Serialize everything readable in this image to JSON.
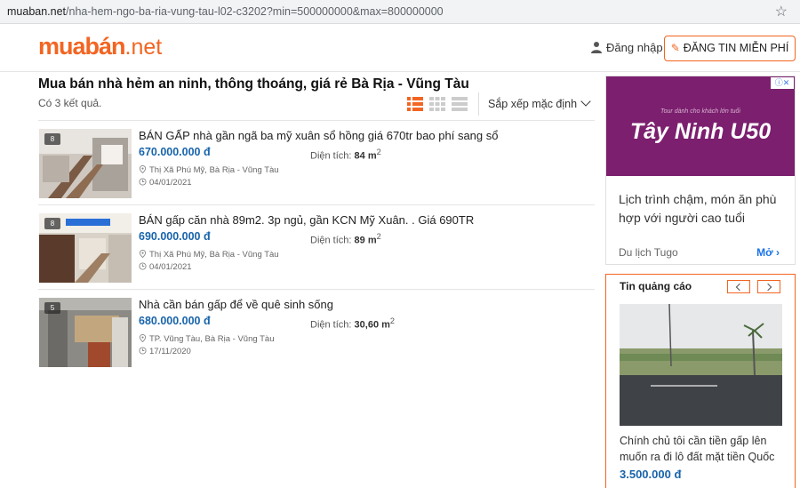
{
  "browser": {
    "url_domain": "muaban.net",
    "url_path": "/nha-hem-ngo-ba-ria-vung-tau-l02-c3202?min=500000000&max=800000000"
  },
  "header": {
    "logo_main": "muabán",
    "logo_suffix": ".net",
    "login_label": "Đăng nhập",
    "post_button_label": "ĐĂNG TIN MIỄN PHÍ"
  },
  "main": {
    "page_title": "Mua bán nhà hẻm an ninh, thông thoáng, giá rẻ Bà Rịa - Vũng Tàu",
    "result_count": "Có 3 kết quả.",
    "sort_label": "Sắp xếp mặc định",
    "listings": [
      {
        "title": "BÁN GẤP nhà gần ngã ba mỹ xuân sổ hồng giá 670tr bao phí sang sổ",
        "price": "670.000.000 đ",
        "area_label": "Diện tích:",
        "area_value": "84 m",
        "area_unit_sup": "2",
        "location": "Thị Xã Phú Mỹ, Bà Rịa - Vũng Tàu",
        "date": "04/01/2021",
        "photo_count": "8"
      },
      {
        "title": "BÁN gấp căn nhà 89m2. 3p ngủ, gần KCN Mỹ Xuân. . Giá 690TR",
        "price": "690.000.000 đ",
        "area_label": "Diện tích:",
        "area_value": "89 m",
        "area_unit_sup": "2",
        "location": "Thị Xã Phú Mỹ, Bà Rịa - Vũng Tàu",
        "date": "04/01/2021",
        "photo_count": "8"
      },
      {
        "title": "Nhà cần bán gấp để về quê sinh sống",
        "price": "680.000.000 đ",
        "area_label": "Diện tích:",
        "area_value": "30,60 m",
        "area_unit_sup": "2",
        "location": "TP. Vũng Tàu, Bà Rịa - Vũng Tàu",
        "date": "17/11/2020",
        "photo_count": "5"
      }
    ]
  },
  "sidebar": {
    "ad_top": {
      "tagline": "Tour dành cho khách lớn tuổi",
      "brand": "Tây Ninh U50",
      "text": "Lịch trình chậm, món ăn phù hợp với người cao tuổi",
      "source": "Du lịch Tugo",
      "open_label": "Mở"
    },
    "ad_box": {
      "title": "Tin quảng cáo",
      "description": "Chính chủ tôi cần tiền gấp lên muốn ra đi lô đất mặt tiền Quốc",
      "price": "3.500.000 đ"
    }
  },
  "colors": {
    "brand_orange": "#f26522",
    "price_blue": "#1864ab",
    "ad_purple": "#7b1f6e"
  }
}
